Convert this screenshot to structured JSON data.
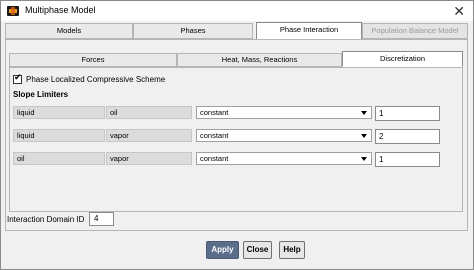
{
  "window": {
    "title": "Multiphase Model",
    "close_glyph": "✕"
  },
  "main_tabs": [
    {
      "label": "Models",
      "active": false,
      "enabled": true
    },
    {
      "label": "Phases",
      "active": false,
      "enabled": true
    },
    {
      "label": "Phase Interaction",
      "active": true,
      "enabled": true
    },
    {
      "label": "Population Balance Model",
      "active": false,
      "enabled": false
    }
  ],
  "sub_tabs": [
    {
      "label": "Forces",
      "active": false
    },
    {
      "label": "Heat, Mass, Reactions",
      "active": false
    },
    {
      "label": "Discretization",
      "active": true
    }
  ],
  "discretization": {
    "compressive_scheme_label": "Phase Localized Compressive Scheme",
    "compressive_scheme_checked": true,
    "slope_limiters_label": "Slope Limiters",
    "rows": [
      {
        "phase1": "liquid",
        "phase2": "oil",
        "method": "constant",
        "value": "1"
      },
      {
        "phase1": "liquid",
        "phase2": "vapor",
        "method": "constant",
        "value": "2"
      },
      {
        "phase1": "oil",
        "phase2": "vapor",
        "method": "constant",
        "value": "1"
      }
    ]
  },
  "interaction_domain": {
    "label": "Interaction Domain ID",
    "value": "4"
  },
  "buttons": {
    "apply": "Apply",
    "close": "Close",
    "help": "Help"
  },
  "colors": {
    "apply_button": "#5a6e8c",
    "panel_bg": "#f0f0f0",
    "readonly_field": "#dcdcdc"
  }
}
